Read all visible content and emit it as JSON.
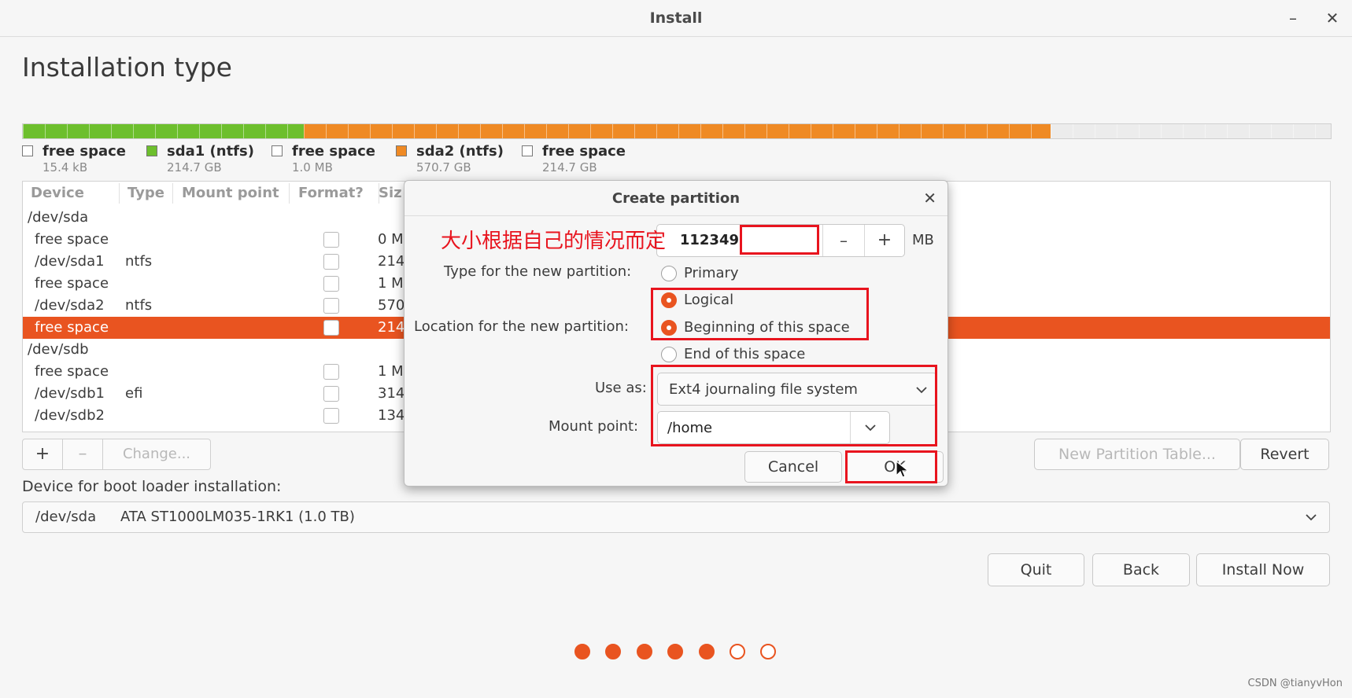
{
  "window": {
    "title": "Install",
    "minimize_glyph": "–",
    "close_glyph": "✕"
  },
  "page": {
    "heading": "Installation type"
  },
  "disk_bar": {
    "segments": [
      {
        "fraction": 0.215,
        "color": "#6dbf2d"
      },
      {
        "fraction": 0.571,
        "color": "#ef8a24"
      },
      {
        "fraction": 0.214,
        "color": "#ececec"
      }
    ]
  },
  "legend": [
    {
      "name": "free space",
      "size": "15.4 kB",
      "color": "#ffffff"
    },
    {
      "name": "sda1 (ntfs)",
      "size": "214.7 GB",
      "color": "#6dbf2d"
    },
    {
      "name": "free space",
      "size": "1.0 MB",
      "color": "#ffffff"
    },
    {
      "name": "sda2 (ntfs)",
      "size": "570.7 GB",
      "color": "#ef8a24"
    },
    {
      "name": "free space",
      "size": "214.7 GB",
      "color": "#ffffff"
    }
  ],
  "table": {
    "headers": [
      "Device",
      "Type",
      "Mount point",
      "Format?",
      "Siz"
    ],
    "rows": [
      {
        "device": "/dev/sda",
        "group": true
      },
      {
        "device": "free space",
        "type": "",
        "size": "0 M"
      },
      {
        "device": "/dev/sda1",
        "type": "ntfs",
        "size": "214"
      },
      {
        "device": "free space",
        "type": "",
        "size": "1 M"
      },
      {
        "device": "/dev/sda2",
        "type": "ntfs",
        "size": "570"
      },
      {
        "device": "free space",
        "type": "",
        "size": "214",
        "selected": true
      },
      {
        "device": "/dev/sdb",
        "group": true
      },
      {
        "device": "free space",
        "type": "",
        "size": "1 M"
      },
      {
        "device": "/dev/sdb1",
        "type": "efi",
        "size": "314"
      },
      {
        "device": "/dev/sdb2",
        "type": "",
        "size": "134"
      }
    ]
  },
  "toolbar": {
    "add": "+",
    "remove": "–",
    "change": "Change...",
    "new_table": "New Partition Table...",
    "revert": "Revert"
  },
  "boot": {
    "label": "Device for boot loader installation:",
    "device": "/dev/sda",
    "description": "ATA ST1000LM035-1RK1 (1.0 TB)"
  },
  "nav": {
    "quit": "Quit",
    "back": "Back",
    "install": "Install Now"
  },
  "progress_dots": {
    "total": 7,
    "completed": 5,
    "color": "#e95420"
  },
  "dialog": {
    "title": "Create partition",
    "close_glyph": "✕",
    "size_value": "112349",
    "size_unit": "MB",
    "minus": "–",
    "plus": "+",
    "type_label": "Type for the new partition:",
    "type_options": [
      {
        "label": "Primary",
        "selected": false
      },
      {
        "label": "Logical",
        "selected": true
      }
    ],
    "location_label": "Location for the new partition:",
    "location_options": [
      {
        "label": "Beginning of this space",
        "selected": true
      },
      {
        "label": "End of this space",
        "selected": false
      }
    ],
    "use_as_label": "Use as:",
    "use_as_value": "Ext4 journaling file system",
    "mount_label": "Mount point:",
    "mount_value": "/home",
    "cancel": "Cancel",
    "ok": "OK"
  },
  "annotation": {
    "text": "大小根据自己的情况而定",
    "color": "#e8141e"
  },
  "watermark": "CSDN @tianyvHon"
}
